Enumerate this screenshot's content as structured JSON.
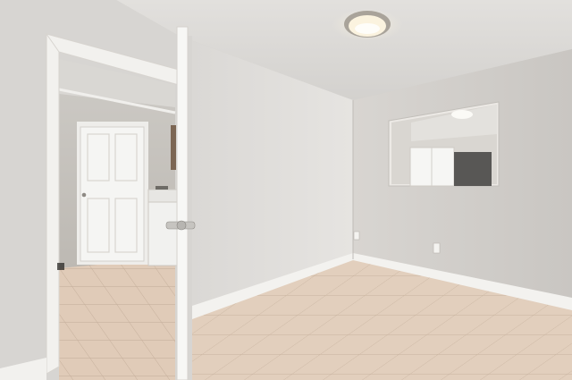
{
  "photo": {
    "subject": "",
    "colors": {
      "ceiling": "#dcdad7",
      "right_wall": "#cfccc8",
      "left_wall": "#dedcd9",
      "floor_tile": "#e2cfbd",
      "grout": "#c9b4a1",
      "baseboard": "#f2f1ee",
      "door_white": "#f3f3f1",
      "light_glow": "#fff4d8",
      "mirror_frame": "#ece9e5"
    }
  },
  "watermark": {
    "text": ""
  }
}
